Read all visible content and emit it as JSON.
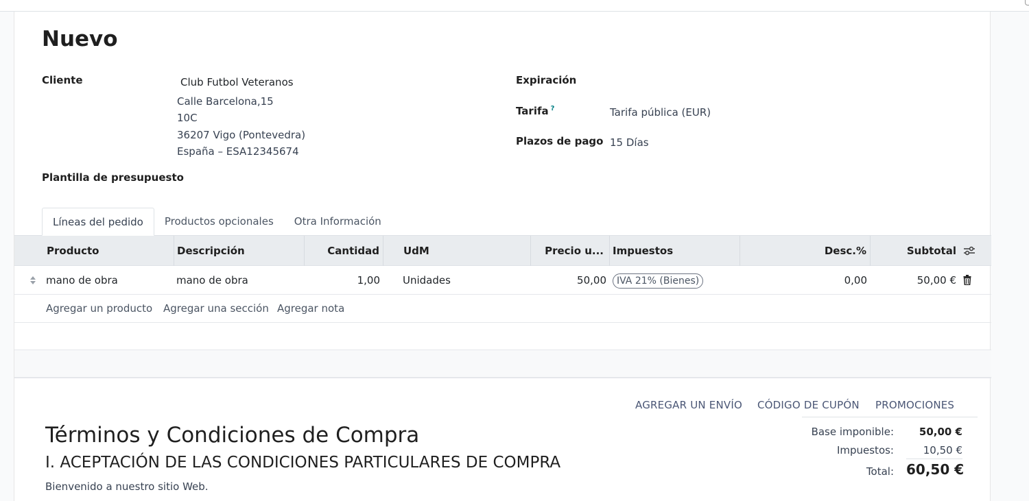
{
  "record": {
    "title": "Nuevo"
  },
  "customer": {
    "label": "Cliente",
    "name": "Club Futbol Veteranos",
    "address_line1": "Calle Barcelona,15",
    "address_line2": "10C",
    "address_line3": "36207 Vigo (Pontevedra)",
    "address_line4": "España – ESA12345674"
  },
  "quote_template": {
    "label": "Plantilla de presupuesto"
  },
  "expiration": {
    "label": "Expiración"
  },
  "pricelist": {
    "label": "Tarifa",
    "help": "?",
    "value": "Tarifa pública (EUR)"
  },
  "payment_terms": {
    "label": "Plazos de pago",
    "value": "15 Días"
  },
  "tabs": [
    {
      "label": "Líneas del pedido",
      "active": true
    },
    {
      "label": "Productos opcionales",
      "active": false
    },
    {
      "label": "Otra Información",
      "active": false
    }
  ],
  "table": {
    "headers": {
      "product": "Producto",
      "description": "Descripción",
      "quantity": "Cantidad",
      "uom": "UdM",
      "price": "Precio u...",
      "taxes": "Impuestos",
      "discount": "Desc.%",
      "subtotal": "Subtotal"
    },
    "rows": [
      {
        "product": "mano de obra",
        "description": "mano de obra",
        "quantity": "1,00",
        "uom": "Unidades",
        "price": "50,00",
        "tax": "IVA 21% (Bienes)",
        "discount": "0,00",
        "subtotal": "50,00 €"
      }
    ],
    "add_links": {
      "product": "Agregar un producto",
      "section": "Agregar una sección",
      "note": "Agregar nota"
    }
  },
  "actions": {
    "shipping": "AGREGAR UN ENVÍO",
    "coupon": "CÓDIGO DE CUPÓN",
    "promotions": "PROMOCIONES"
  },
  "totals": {
    "base_label": "Base imponible:",
    "base_value": "50,00 €",
    "tax_label": "Impuestos:",
    "tax_value": "10,50 €",
    "total_label": "Total:",
    "total_value": "60,50 €"
  },
  "terms": {
    "heading": "Términos y Condiciones de Compra",
    "subheading": "I. ACEPTACIÓN DE LAS CONDICIONES PARTICULARES DE COMPRA",
    "paragraph": "Bienvenido a nuestro sitio Web."
  },
  "icons": {
    "optional_columns": "sliders-icon",
    "delete": "trash-icon",
    "drag": "drag-handle-icon"
  },
  "colors": {
    "link": "#4a5675",
    "header_bg": "#e9ecef",
    "help": "#017e84"
  }
}
